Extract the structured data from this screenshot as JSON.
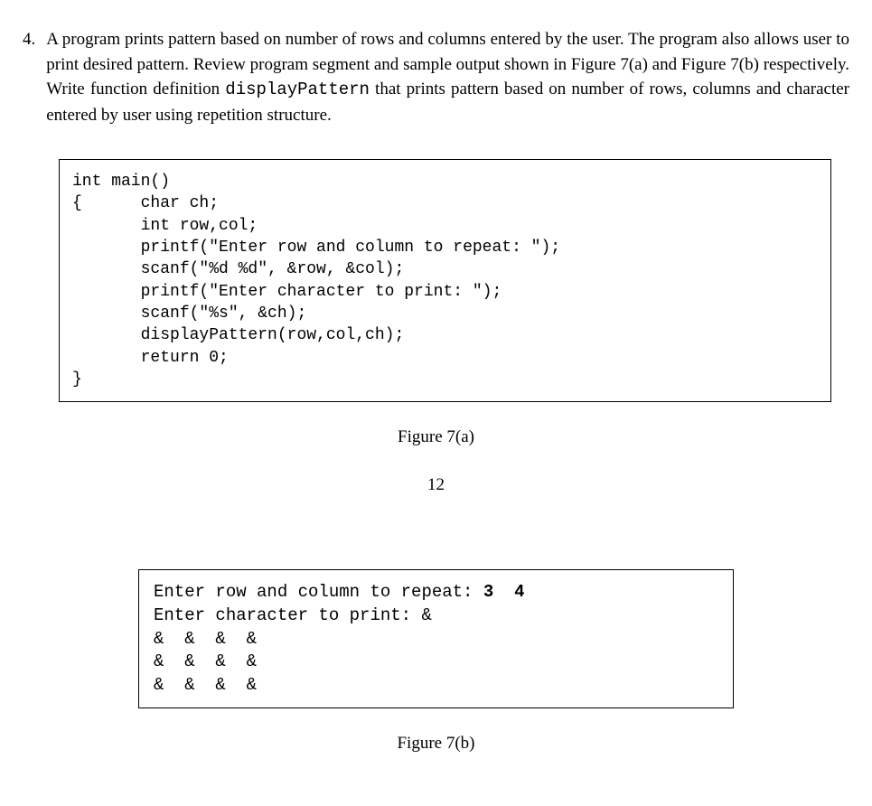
{
  "question": {
    "number": "4.",
    "text_parts": [
      "A program prints pattern based on number of rows and columns entered by the user. The program also allows user to print desired pattern. Review program segment and sample output shown in Figure 7(a) and Figure 7(b) respectively. Write function definition ",
      "displayPattern",
      " that prints pattern based on number of rows, columns and character entered by user using repetition structure."
    ]
  },
  "code_block": "int main()\n{      char ch;\n       int row,col;\n       printf(\"Enter row and column to repeat: \");\n       scanf(\"%d %d\", &row, &col);\n       printf(\"Enter character to print: \");\n       scanf(\"%s\", &ch);\n       displayPattern(row,col,ch);\n       return 0;\n}",
  "caption_a": "Figure 7(a)",
  "page_number": "12",
  "output_block": {
    "line1_prefix": "Enter row and column to repeat: ",
    "line1_bold": "3  4",
    "rest": "Enter character to print: &\n&  &  &  &\n&  &  &  &\n&  &  &  &"
  },
  "caption_b": "Figure 7(b)"
}
